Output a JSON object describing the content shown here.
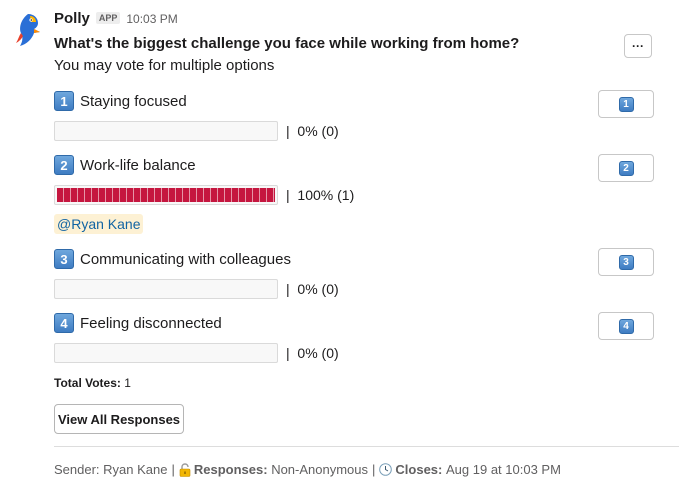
{
  "app": {
    "sender_name": "Polly",
    "badge": "APP",
    "time": "10:03 PM",
    "more_label": "···"
  },
  "poll": {
    "question": "What's the biggest challenge you face while working from home?",
    "subtitle": "You may vote for multiple options",
    "options": [
      {
        "number": "1",
        "label": "Staying focused",
        "result": "0% (0)",
        "percent": 0
      },
      {
        "number": "2",
        "label": "Work-life balance",
        "result": "100% (1)",
        "percent": 100,
        "voter": "@Ryan Kane"
      },
      {
        "number": "3",
        "label": "Communicating with colleagues",
        "result": "0% (0)",
        "percent": 0
      },
      {
        "number": "4",
        "label": "Feeling disconnected",
        "result": "0% (0)",
        "percent": 0
      }
    ],
    "bar_color": "#c5163f",
    "total_label": "Total Votes:",
    "total_value": "1",
    "view_button": "View All Responses"
  },
  "footer": {
    "sender": "Sender: Ryan Kane",
    "responses_label": "Responses:",
    "responses_value": "Non-Anonymous",
    "closes_label": "Closes:",
    "closes_value": "Aug 19 at 10:03 PM",
    "lock_icon": "lock-icon",
    "clock_icon": "clock-icon"
  },
  "colors": {
    "link": "#1264a3",
    "mention_bg": "#fdf1d4",
    "keycap": "#3e7cc2"
  }
}
